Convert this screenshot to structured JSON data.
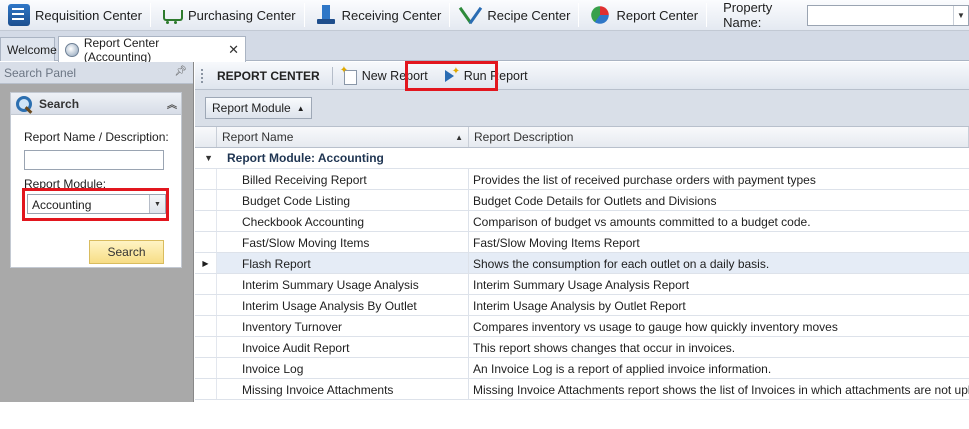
{
  "toolbar": {
    "requisition": "Requisition Center",
    "purchasing": "Purchasing Center",
    "receiving": "Receiving Center",
    "recipe": "Recipe Center",
    "report": "Report Center",
    "property_label": "Property Name:",
    "property_value": ""
  },
  "tabs": {
    "welcome": "Welcome",
    "active": "Report Center (Accounting)",
    "close": "✕"
  },
  "search_panel": {
    "title": "Search Panel",
    "box_title": "Search",
    "name_label": "Report Name / Description:",
    "name_value": "",
    "module_label": "Report Module:",
    "module_value": "Accounting",
    "search_button": "Search"
  },
  "main": {
    "title": "REPORT CENTER",
    "new_report": "New Report",
    "run_report": "Run Report",
    "group_chip": "Report Module",
    "columns": {
      "name": "Report Name",
      "description": "Report Description"
    },
    "group_label": "Report Module: Accounting",
    "rows": [
      {
        "name": "Billed Receiving Report",
        "description": "Provides the list of received purchase orders with payment types"
      },
      {
        "name": "Budget Code Listing",
        "description": "Budget Code Details for Outlets and Divisions"
      },
      {
        "name": "Checkbook Accounting",
        "description": "Comparison of budget vs amounts committed to a budget code."
      },
      {
        "name": "Fast/Slow Moving Items",
        "description": "Fast/Slow Moving Items Report"
      },
      {
        "name": "Flash Report",
        "description": "Shows the consumption for each outlet on a daily basis."
      },
      {
        "name": "Interim Summary Usage Analysis",
        "description": "Interim Summary Usage Analysis Report"
      },
      {
        "name": "Interim Usage Analysis By Outlet",
        "description": "Interim Usage Analysis by Outlet Report"
      },
      {
        "name": "Inventory Turnover",
        "description": "Compares inventory vs usage to gauge how quickly inventory moves"
      },
      {
        "name": "Invoice Audit Report",
        "description": "This report shows changes that occur in invoices."
      },
      {
        "name": "Invoice Log",
        "description": "An Invoice Log is a report of applied invoice information."
      },
      {
        "name": "Missing Invoice Attachments",
        "description": "Missing Invoice Attachments report shows the list of Invoices in which attachments are not uploaded."
      }
    ],
    "selected_row": "Flash Report"
  },
  "icons": {
    "requisition": "requisition-icon",
    "purchasing": "cart-icon",
    "receiving": "receiving-icon",
    "recipe": "fork-knife-icon",
    "report": "pie-chart-icon",
    "search": "magnifier-icon",
    "new_report": "new-document-icon",
    "run_report": "run-icon"
  },
  "colors": {
    "highlight": "#e2161e",
    "selected_row": "#e5ecf6",
    "search_button": "#f7dd86"
  }
}
